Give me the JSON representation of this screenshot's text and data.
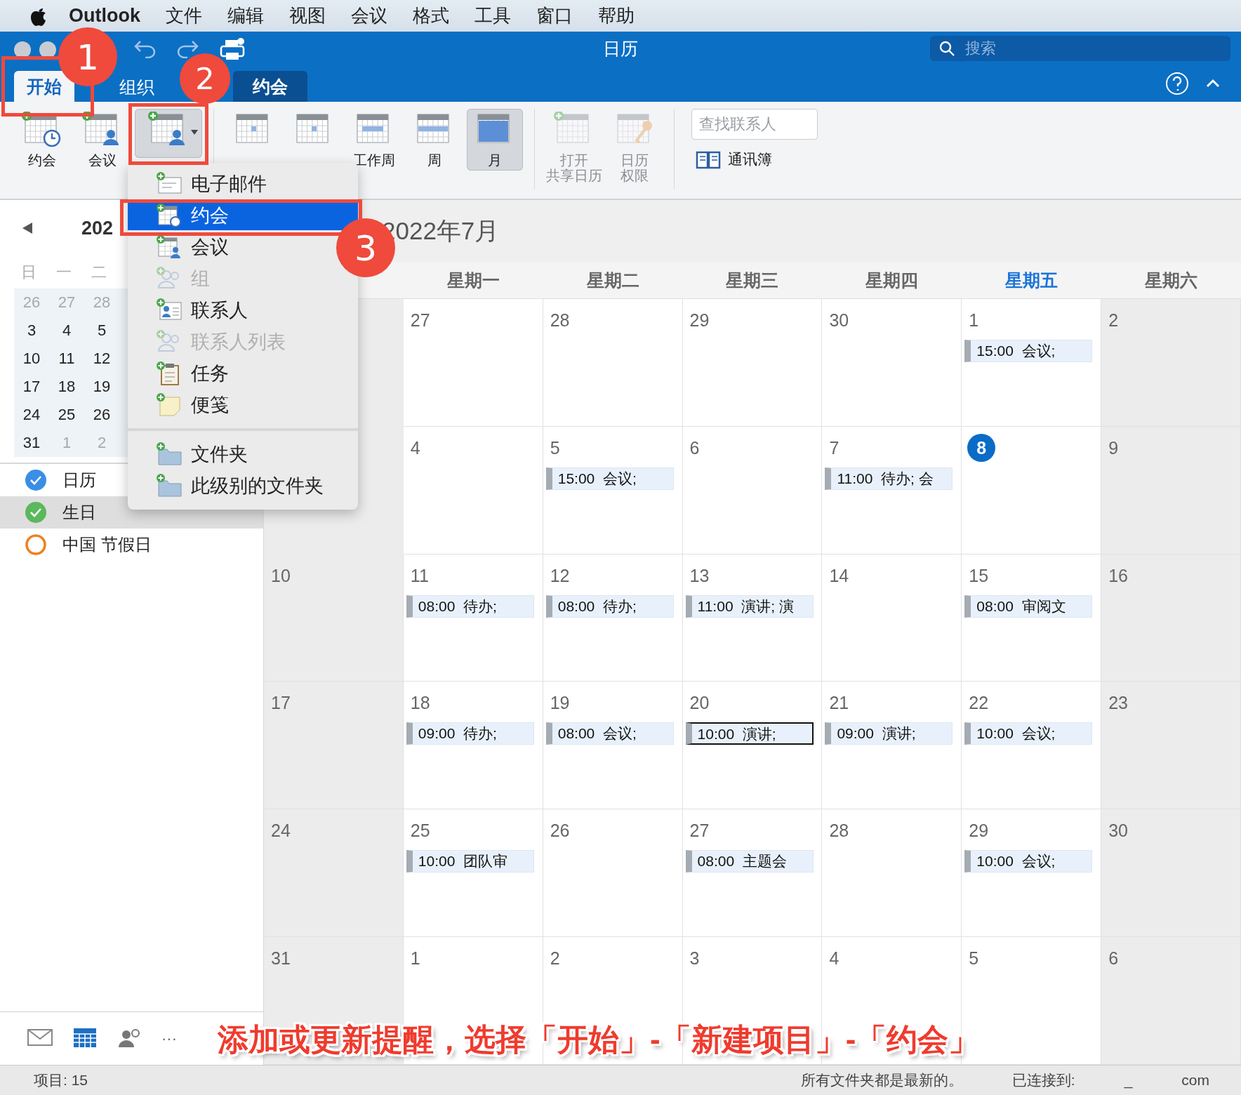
{
  "menu_bar": {
    "app": "Outlook",
    "items": [
      "文件",
      "编辑",
      "视图",
      "会议",
      "格式",
      "工具",
      "窗口",
      "帮助"
    ]
  },
  "window": {
    "title": "日历",
    "search": {
      "placeholder": "搜索"
    }
  },
  "tabs": [
    {
      "label": "开始",
      "selected": true,
      "kind": "normal"
    },
    {
      "label": "组织",
      "selected": false,
      "kind": "normal"
    },
    {
      "label": "约会",
      "selected": false,
      "kind": "context"
    }
  ],
  "ribbon": {
    "buttons": [
      {
        "lines": [
          "约会"
        ],
        "selected": false,
        "disabled": false
      },
      {
        "lines": [
          "会议"
        ],
        "selected": false,
        "disabled": false
      },
      {
        "selected": true,
        "disabled": false
      },
      {
        "selected": false,
        "disabled": false
      },
      {
        "selected": false,
        "disabled": false
      },
      {
        "lines": [
          "工作周"
        ],
        "selected": false,
        "disabled": false
      },
      {
        "lines": [
          "周"
        ],
        "selected": false,
        "disabled": false
      },
      {
        "lines": [
          "月"
        ],
        "selected": true,
        "disabled": false
      },
      {
        "lines": [
          "打开",
          "共享日历"
        ],
        "selected": false,
        "disabled": true
      },
      {
        "lines": [
          "日历",
          "权限"
        ],
        "selected": false,
        "disabled": true
      }
    ],
    "contact_search": {
      "placeholder": "查找联系人"
    },
    "address_book": "通讯簿"
  },
  "new_item_menu": [
    {
      "label": "电子邮件",
      "selected": false,
      "disabled": false
    },
    {
      "label": "约会",
      "selected": true,
      "disabled": false
    },
    {
      "label": "会议",
      "selected": false,
      "disabled": false
    },
    {
      "label": "组",
      "selected": false,
      "disabled": true
    },
    {
      "label": "联系人",
      "selected": false,
      "disabled": false
    },
    {
      "label": "联系人列表",
      "selected": false,
      "disabled": true
    },
    {
      "label": "任务",
      "selected": false,
      "disabled": false
    },
    {
      "label": "便笺",
      "selected": false,
      "disabled": false
    },
    {
      "label": "文件夹",
      "selected": false,
      "disabled": false
    },
    {
      "label": "此级别的文件夹",
      "selected": false,
      "disabled": false
    }
  ],
  "mini_calendar": {
    "title": "202",
    "weekdays": [
      "日",
      "一",
      "二"
    ],
    "weeks": [
      [
        {
          "day": "26",
          "muted": true
        },
        {
          "day": "27",
          "muted": true
        },
        {
          "day": "28",
          "muted": true
        }
      ],
      [
        {
          "day": "3",
          "muted": false
        },
        {
          "day": "4",
          "muted": false
        },
        {
          "day": "5",
          "muted": false
        }
      ],
      [
        {
          "day": "10",
          "muted": false
        },
        {
          "day": "11",
          "muted": false
        },
        {
          "day": "12",
          "muted": false
        }
      ],
      [
        {
          "day": "17",
          "muted": false
        },
        {
          "day": "18",
          "muted": false
        },
        {
          "day": "19",
          "muted": false
        }
      ],
      [
        {
          "day": "24",
          "muted": false
        },
        {
          "day": "25",
          "muted": false
        },
        {
          "day": "26",
          "muted": false
        }
      ],
      [
        {
          "day": "31",
          "muted": false
        },
        {
          "day": "1",
          "muted": true
        },
        {
          "day": "2",
          "muted": true
        }
      ]
    ]
  },
  "calendars": [
    {
      "label": "日历",
      "checked": true,
      "color": "#3a8ee6",
      "selected": false
    },
    {
      "label": "生日",
      "checked": true,
      "color": "#5cb85c",
      "selected": true
    },
    {
      "label": "中国 节假日",
      "checked": false,
      "color": "#f07f1e",
      "selected": false
    }
  ],
  "month_view": {
    "title": "2022年7月",
    "weekdays": [
      {
        "weekend": true
      },
      {
        "label": "星期一",
        "weekend": false,
        "today": false
      },
      {
        "label": "星期二",
        "weekend": false,
        "today": false
      },
      {
        "label": "星期三",
        "weekend": false,
        "today": false
      },
      {
        "label": "星期四",
        "weekend": false,
        "today": false
      },
      {
        "label": "星期五",
        "weekend": false,
        "today": true
      },
      {
        "label": "星期六",
        "weekend": true,
        "today": false
      }
    ],
    "weeks": [
      [
        {
          "day": "27",
          "today": false
        },
        {
          "day": "28",
          "today": false
        },
        {
          "day": "29",
          "today": false
        },
        {
          "day": "30",
          "today": false
        },
        {
          "day": "1",
          "today": false,
          "events": [
            {
              "text": "15:00  会议;",
              "selected": false
            }
          ]
        },
        {
          "day": "2",
          "today": false
        }
      ],
      [
        {
          "day": "4",
          "today": false
        },
        {
          "day": "5",
          "today": false,
          "events": [
            {
              "text": "15:00  会议;",
              "selected": false
            }
          ]
        },
        {
          "day": "6",
          "today": false
        },
        {
          "day": "7",
          "today": false,
          "events": [
            {
              "text": "11:00  待办; 会",
              "selected": false
            }
          ]
        },
        {
          "day": "8",
          "today": true
        },
        {
          "day": "9",
          "today": false
        }
      ],
      [
        {
          "day": "10",
          "today": false
        },
        {
          "day": "11",
          "today": false,
          "events": [
            {
              "text": "08:00  待办;",
              "selected": false
            }
          ]
        },
        {
          "day": "12",
          "today": false,
          "events": [
            {
              "text": "08:00  待办;",
              "selected": false
            }
          ]
        },
        {
          "day": "13",
          "today": false,
          "events": [
            {
              "text": "11:00  演讲; 演",
              "selected": false
            }
          ]
        },
        {
          "day": "14",
          "today": false
        },
        {
          "day": "15",
          "today": false,
          "events": [
            {
              "text": "08:00  审阅文",
              "selected": false
            }
          ]
        },
        {
          "day": "16",
          "today": false
        }
      ],
      [
        {
          "day": "17",
          "today": false
        },
        {
          "day": "18",
          "today": false,
          "events": [
            {
              "text": "09:00  待办;",
              "selected": false
            }
          ]
        },
        {
          "day": "19",
          "today": false,
          "events": [
            {
              "text": "08:00  会议;",
              "selected": false
            }
          ]
        },
        {
          "day": "20",
          "today": false,
          "events": [
            {
              "text": "10:00  演讲;",
              "selected": true
            }
          ]
        },
        {
          "day": "21",
          "today": false,
          "events": [
            {
              "text": "09:00  演讲;",
              "selected": false
            }
          ]
        },
        {
          "day": "22",
          "today": false,
          "events": [
            {
              "text": "10:00  会议;",
              "selected": false
            }
          ]
        },
        {
          "day": "23",
          "today": false
        }
      ],
      [
        {
          "day": "24",
          "today": false
        },
        {
          "day": "25",
          "today": false,
          "events": [
            {
              "text": "10:00  团队审",
              "selected": false
            }
          ]
        },
        {
          "day": "26",
          "today": false
        },
        {
          "day": "27",
          "today": false,
          "events": [
            {
              "text": "08:00  主题会",
              "selected": false
            }
          ]
        },
        {
          "day": "28",
          "today": false
        },
        {
          "day": "29",
          "today": false,
          "events": [
            {
              "text": "10:00  会议;",
              "selected": false
            }
          ]
        },
        {
          "day": "30",
          "today": false
        }
      ],
      [
        {
          "day": "31",
          "today": false
        },
        {
          "day": "1",
          "today": false
        },
        {
          "day": "2",
          "today": false
        },
        {
          "day": "3",
          "today": false
        },
        {
          "day": "4",
          "today": false
        },
        {
          "day": "5",
          "today": false
        },
        {
          "day": "6",
          "today": false
        }
      ]
    ]
  },
  "bottom_nav": [
    {
      "selected": false
    },
    {
      "selected": true
    },
    {
      "selected": false
    },
    {
      "label": "···",
      "selected": false
    }
  ],
  "status_bar": [
    "项目: 15",
    "所有文件夹都是最新的。",
    "已连接到:",
    "_",
    "com"
  ],
  "annotations": {
    "steps": [
      "1",
      "2",
      "3"
    ],
    "caption": "添加或更新提醒，选择「开始」-「新建项目」-「约会」"
  }
}
